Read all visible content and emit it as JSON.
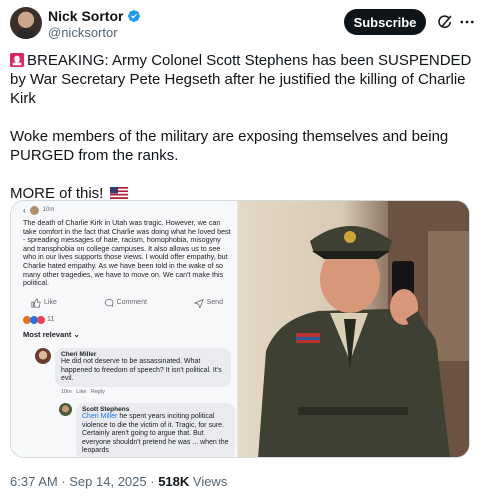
{
  "author": {
    "display_name": "Nick Sortor",
    "handle": "@nicksortor"
  },
  "header": {
    "subscribe_label": "Subscribe"
  },
  "tweet": {
    "line1": "BREAKING: Army Colonel Scott Stephens has been SUSPENDED by War Secretary Pete Hegseth after he justified the killing of Charlie Kirk",
    "line2": "Woke members of the military are exposing themselves and being PURGED from the ranks.",
    "line3": "MORE of this!",
    "emoji_lead": "siren-emoji",
    "emoji_tail": "us-flag-emoji"
  },
  "screenshot": {
    "post_time": "10m",
    "post_body": "The death of Charlie Kirk in Utah was tragic. However, we can take comfort in the fact that Charlie was doing what he loved best - spreading messages of hate, racism, homophobia, misogyny and transphobia on college campuses. It also allows us to see who in our lives supports those views. I would offer empathy, but Charlie hated empathy. As we have been told in the wake of so many other tragedies, we have to move on. We can't make this political.",
    "like_label": "Like",
    "comment_label": "Comment",
    "send_label": "Send",
    "reaction_count": "11",
    "filter_label": "Most relevant",
    "comment1": {
      "name": "Cheri Miller",
      "text": "He did not deserve to be assassinated. What happened to freedom of speech? It isn't political. It's evil.",
      "meta_time": "10m",
      "meta_like": "Like",
      "meta_reply": "Reply"
    },
    "comment2": {
      "name": "Scott Stephens",
      "mention": "Cheri Miller",
      "text": " he spent years inciting political violence to die the victim of it. Tragic, for sure. Certainly aren't going to argue that. But everyone shouldn't pretend he was ... when the leopards"
    }
  },
  "footer": {
    "time": "6:37 AM",
    "separator": " · ",
    "date": "Sep 14, 2025",
    "views_count": "518K",
    "views_label": " Views"
  },
  "colors": {
    "text": "#0f1419",
    "muted": "#536471",
    "verified": "#1d9bf0",
    "facebook_blue": "#1877f2"
  }
}
